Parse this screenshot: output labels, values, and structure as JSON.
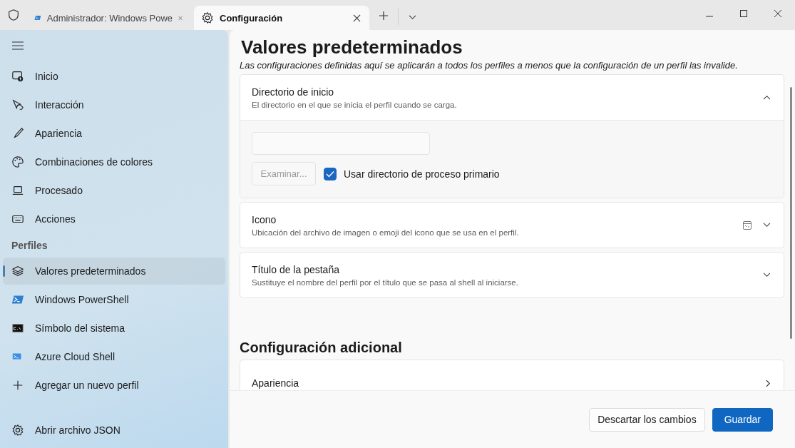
{
  "tabs": [
    {
      "label": "Administrador: Windows Powe",
      "kind": "powershell",
      "selected": false
    },
    {
      "label": "Configuración",
      "kind": "settings",
      "selected": true
    }
  ],
  "sidebar": {
    "items": [
      {
        "label": "Inicio",
        "kind": "home",
        "selected": false
      },
      {
        "label": "Interacción",
        "kind": "pointer",
        "selected": false
      },
      {
        "label": "Apariencia",
        "kind": "brush",
        "selected": false
      },
      {
        "label": "Combinaciones de colores",
        "kind": "palette",
        "selected": false
      },
      {
        "label": "Procesado",
        "kind": "laptop",
        "selected": false
      },
      {
        "label": "Acciones",
        "kind": "keyboard",
        "selected": false
      }
    ],
    "section": "Perfiles",
    "profiles": [
      {
        "label": "Valores predeterminados",
        "kind": "layers",
        "selected": true
      },
      {
        "label": "Windows PowerShell",
        "kind": "powershell",
        "selected": false
      },
      {
        "label": "Símbolo del sistema",
        "kind": "cmd",
        "selected": false
      },
      {
        "label": "Azure Cloud Shell",
        "kind": "azure",
        "selected": false
      },
      {
        "label": "Agregar un nuevo perfil",
        "kind": "plus",
        "selected": false
      }
    ],
    "footer_item": {
      "label": "Abrir archivo JSON",
      "kind": "gear"
    }
  },
  "main": {
    "title": "Valores predeterminados",
    "description": "Las configuraciones definidas aquí se aplicarán a todos los perfiles a menos que la configuración de un perfil las invalide.",
    "cards": [
      {
        "title": "Directorio de inicio",
        "description": "El directorio en el que se inicia el perfil cuando se carga.",
        "expanded": true,
        "preview": false
      },
      {
        "title": "Icono",
        "description": "Ubicación del archivo de imagen o emoji del icono que se usa en el perfil.",
        "expanded": false,
        "preview": true
      },
      {
        "title": "Título de la pestaña",
        "description": "Sustituye el nombre del perfil por el título que se pasa al shell al iniciarse.",
        "expanded": false,
        "preview": false
      }
    ],
    "startup": {
      "browse_button": "Examinar...",
      "browse_disabled": true,
      "checkbox": {
        "label": "Usar directorio de proceso primario",
        "checked": true
      }
    },
    "section2": "Configuración adicional",
    "links": [
      {
        "title": "Apariencia"
      }
    ]
  },
  "buttons": [
    {
      "label": "Descartar los cambios",
      "kind": "secondary"
    },
    {
      "label": "Guardar",
      "kind": "primary"
    }
  ]
}
